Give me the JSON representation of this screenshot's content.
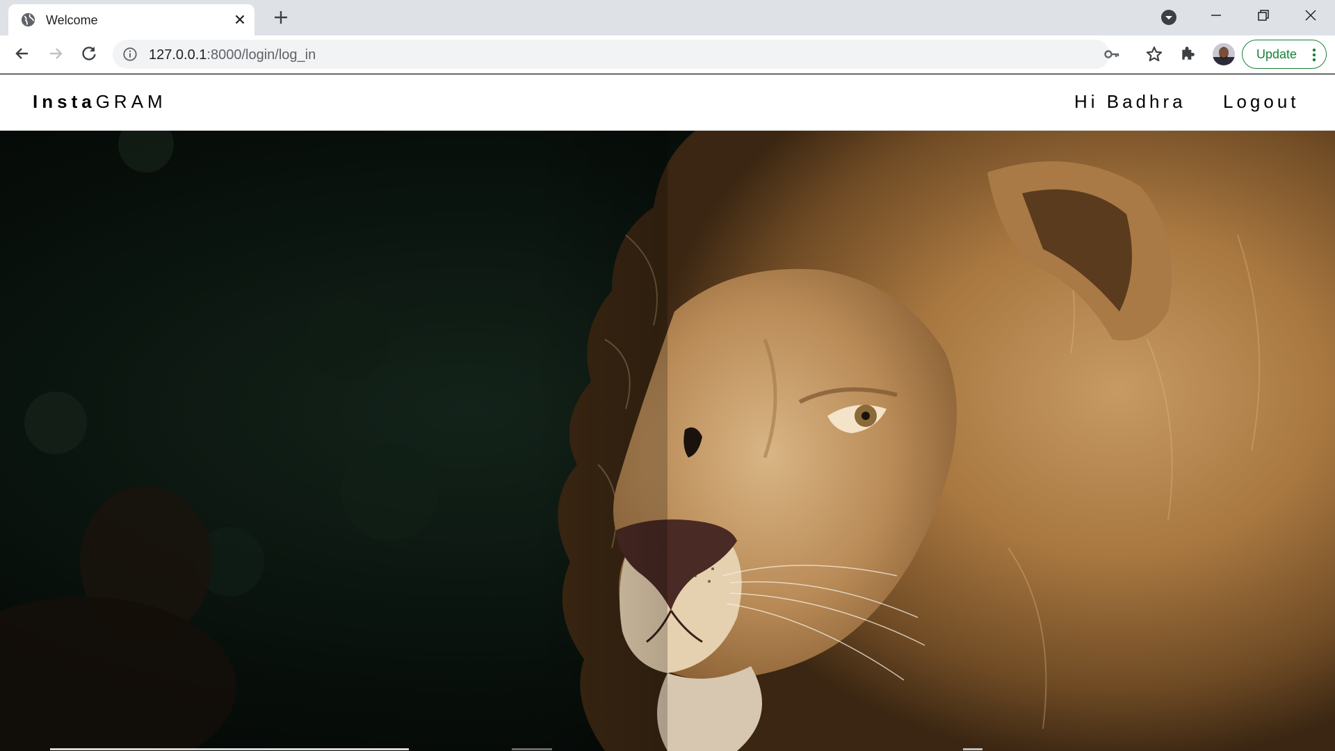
{
  "browser": {
    "tab": {
      "title": "Welcome",
      "favicon": "globe-icon"
    },
    "url": {
      "host": "127.0.0.1",
      "rest": ":8000/login/log_in"
    },
    "update_label": "Update",
    "colors": {
      "tabbar": "#dee1e6",
      "update_green": "#188038"
    }
  },
  "site": {
    "brand": {
      "bold": "Insta",
      "light": "GRAM"
    },
    "greeting": "Hi Badhra",
    "logout": "Logout"
  },
  "hero": {
    "subject": "lion-photo"
  }
}
